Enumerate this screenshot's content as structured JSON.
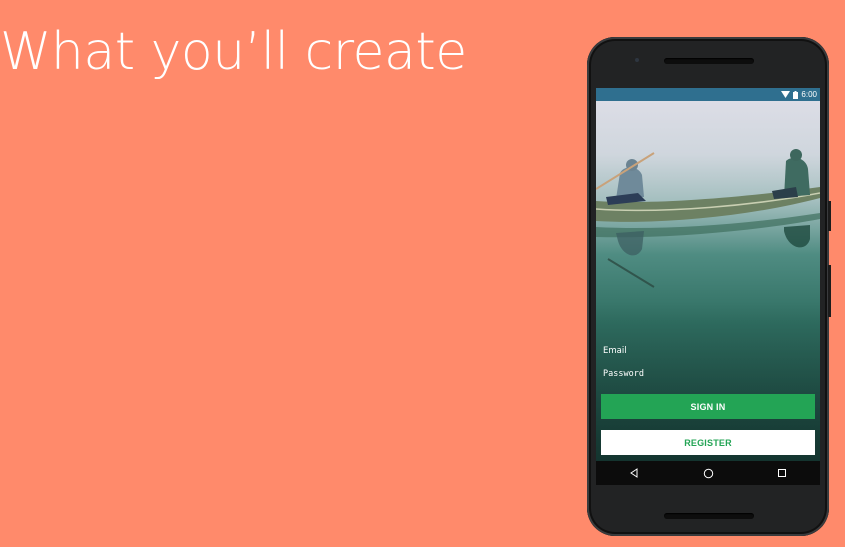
{
  "slide": {
    "title": "What you’ll create"
  },
  "colors": {
    "background": "#FF8A6B",
    "accent_green": "#23A455",
    "status_bar": "#2f6f8f",
    "nav_bar": "#0c0c0c"
  },
  "status_bar": {
    "time": "6:00",
    "icons": [
      "wifi-icon",
      "battery-icon"
    ]
  },
  "login": {
    "email_placeholder": "Email",
    "password_placeholder": "Password",
    "sign_in_label": "SIGN IN",
    "register_label": "REGISTER"
  },
  "nav_bar": {
    "buttons": [
      "back-icon",
      "home-icon",
      "recents-icon"
    ]
  }
}
